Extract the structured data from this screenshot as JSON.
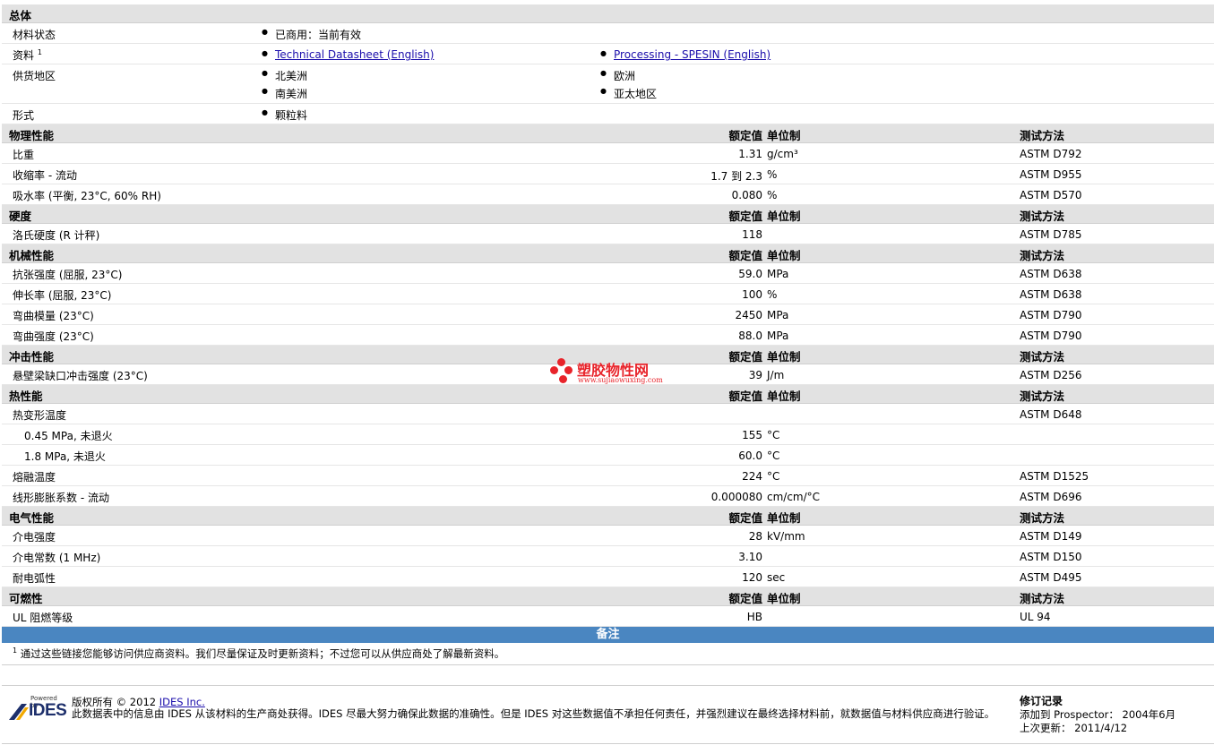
{
  "headers": {
    "value": "额定值",
    "unit": "单位制",
    "test": "测试方法"
  },
  "overview": {
    "title": "总体",
    "status": {
      "label": "材料状态",
      "value": "已商用：当前有效"
    },
    "docs": {
      "label": "资料",
      "sup": "1",
      "links": [
        "Technical Datasheet (English)",
        "Processing - SPESIN (English)"
      ]
    },
    "regions": {
      "label": "供货地区",
      "items": [
        "北美洲",
        "欧洲",
        "南美洲",
        "亚太地区"
      ]
    },
    "form": {
      "label": "形式",
      "value": "颗粒料"
    }
  },
  "sections": [
    {
      "title": "物理性能",
      "rows": [
        {
          "label": "比重",
          "value": "1.31",
          "unit": "g/cm³",
          "test": "ASTM D792"
        },
        {
          "label": "收缩率 - 流动",
          "value": "1.7 到  2.3",
          "unit": "%",
          "test": "ASTM D955"
        },
        {
          "label": "吸水率 (平衡, 23°C, 60% RH)",
          "value": "0.080",
          "unit": "%",
          "test": "ASTM D570"
        }
      ]
    },
    {
      "title": "硬度",
      "rows": [
        {
          "label": "洛氏硬度 (R 计秤)",
          "value": "118",
          "unit": "",
          "test": "ASTM D785"
        }
      ]
    },
    {
      "title": "机械性能",
      "rows": [
        {
          "label": "抗张强度 (屈服, 23°C)",
          "value": "59.0",
          "unit": "MPa",
          "test": "ASTM D638"
        },
        {
          "label": "伸长率 (屈服, 23°C)",
          "value": "100",
          "unit": "%",
          "test": "ASTM D638"
        },
        {
          "label": "弯曲模量 (23°C)",
          "value": "2450",
          "unit": "MPa",
          "test": "ASTM D790"
        },
        {
          "label": "弯曲强度 (23°C)",
          "value": "88.0",
          "unit": "MPa",
          "test": "ASTM D790"
        }
      ]
    },
    {
      "title": "冲击性能",
      "rows": [
        {
          "label": "悬壁梁缺口冲击强度 (23°C)",
          "value": "39",
          "unit": "J/m",
          "test": "ASTM D256"
        }
      ]
    },
    {
      "title": "热性能",
      "rows": [
        {
          "label": "热变形温度",
          "value": "",
          "unit": "",
          "test": "ASTM D648"
        },
        {
          "label": "0.45 MPa, 未退火",
          "sub": true,
          "value": "155",
          "unit": "°C",
          "test": ""
        },
        {
          "label": "1.8 MPa, 未退火",
          "sub": true,
          "value": "60.0",
          "unit": "°C",
          "test": ""
        },
        {
          "label": "熔融温度",
          "value": "224",
          "unit": "°C",
          "test": "ASTM D1525"
        },
        {
          "label": "线形膨胀系数 - 流动",
          "value": "0.000080",
          "unit": "cm/cm/°C",
          "test": "ASTM D696"
        }
      ]
    },
    {
      "title": "电气性能",
      "rows": [
        {
          "label": "介电强度",
          "value": "28",
          "unit": "kV/mm",
          "test": "ASTM D149"
        },
        {
          "label": "介电常数 (1 MHz)",
          "value": "3.10",
          "unit": "",
          "test": "ASTM D150"
        },
        {
          "label": "耐电弧性",
          "value": "120",
          "unit": "sec",
          "test": "ASTM D495"
        }
      ]
    },
    {
      "title": "可燃性",
      "rows": [
        {
          "label": "UL 阻燃等级",
          "value": "HB",
          "unit": "",
          "test": "UL 94"
        }
      ]
    }
  ],
  "notes": {
    "title": "备注",
    "sup": "1",
    "text": "通过这些链接您能够访问供应商资料。我们尽量保证及时更新资料；不过您可以从供应商处了解最新资料。"
  },
  "footer": {
    "logo_powered": "Powered by",
    "logo_name": "IDES",
    "copyright": "版权所有  © 2012",
    "company_link": "IDES Inc.",
    "disclaimer": "此数据表中的信息由  IDES 从该材料的生产商处获得。IDES 尽最大努力确保此数据的准确性。但是  IDES 对这些数据值不承担任何责任，并强烈建议在最终选择材料前，就数据值与材料供应商进行验证。",
    "revision_title": "修订记录",
    "added": "添加到  Prospector：  2004年6月",
    "updated": "上次更新：    2011/4/12"
  },
  "watermark": {
    "cn": "塑胶物性网",
    "url": "www.sujiaowuxing.com"
  },
  "colors": {
    "section_bg": "#e2e2e2",
    "notes_bar": "#4a86c1",
    "link": "#1a0dab",
    "watermark": "#e8232a"
  }
}
